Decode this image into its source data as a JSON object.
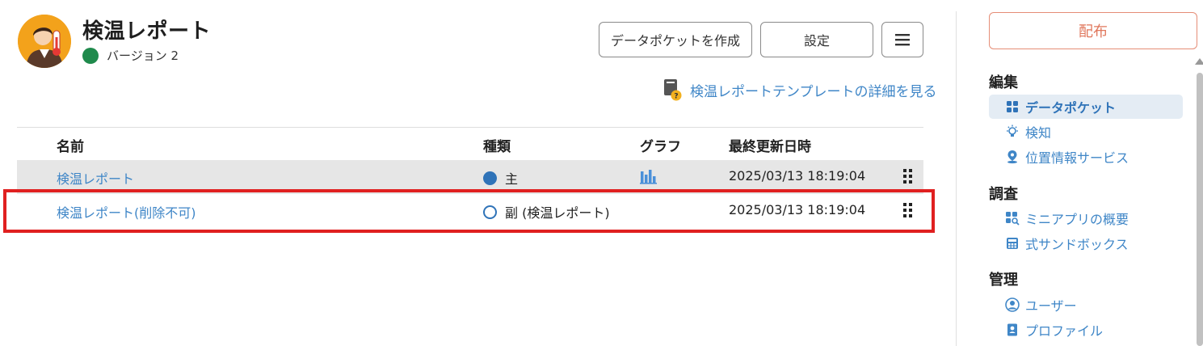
{
  "app": {
    "title": "検温レポート",
    "version_label": "バージョン 2"
  },
  "toolbar": {
    "create_label": "データポケットを作成",
    "settings_label": "設定"
  },
  "template_link": "検温レポートテンプレートの詳細を見る",
  "table": {
    "headers": {
      "name": "名前",
      "kind": "種類",
      "graph": "グラフ",
      "updated": "最終更新日時"
    },
    "rows": [
      {
        "name": "検温レポート",
        "kind": "主",
        "updated": "2025/03/13 18:19:04"
      },
      {
        "name": "検温レポート(削除不可)",
        "kind": "副 (検温レポート)",
        "updated": "2025/03/13 18:19:04"
      }
    ]
  },
  "sidebar": {
    "distribute_label": "配布",
    "sections": [
      {
        "title": "編集",
        "items": [
          {
            "label": "データポケット",
            "icon": "grid-icon"
          },
          {
            "label": "検知",
            "icon": "bulb-icon"
          },
          {
            "label": "位置情報サービス",
            "icon": "location-icon"
          }
        ]
      },
      {
        "title": "調査",
        "items": [
          {
            "label": "ミニアプリの概要",
            "icon": "grid-search-icon"
          },
          {
            "label": "式サンドボックス",
            "icon": "calculator-icon"
          }
        ]
      },
      {
        "title": "管理",
        "items": [
          {
            "label": "ユーザー",
            "icon": "user-circle-icon"
          },
          {
            "label": "プロファイル",
            "icon": "profile-icon"
          }
        ]
      }
    ]
  },
  "colors": {
    "link": "#3f86c7",
    "highlight": "#e02020",
    "version_dot": "#1f8a4c",
    "distribute": "#e0775c",
    "avatar_bg": "#f3a21b"
  }
}
